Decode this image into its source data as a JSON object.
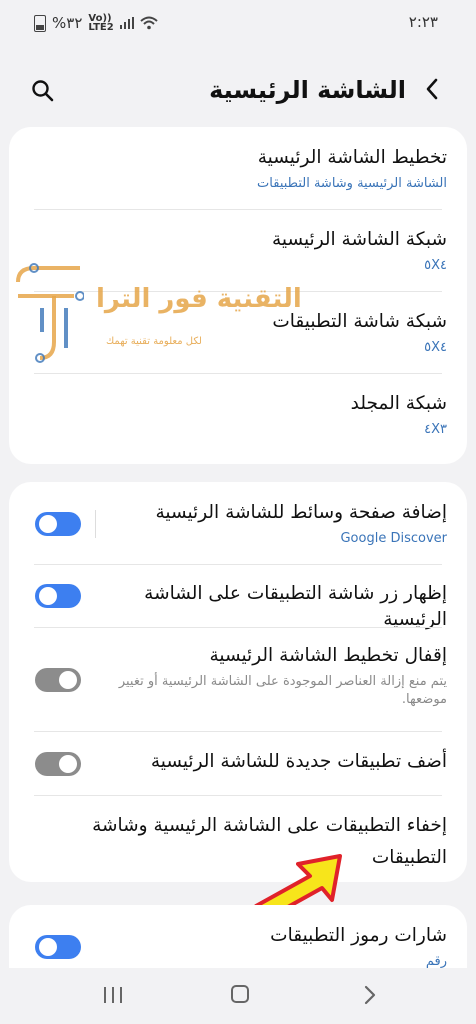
{
  "status_bar": {
    "battery": "%٣٢",
    "signal": "Vo))\nLTE2",
    "time": "٢:٢٣"
  },
  "header": {
    "title": "الشاشة الرئيسية"
  },
  "section1": {
    "items": [
      {
        "title": "تخطيط الشاشة الرئيسية",
        "subtitle": "الشاشة الرئيسية وشاشة التطبيقات"
      },
      {
        "title": "شبكة الشاشة الرئيسية",
        "subtitle": "٥X٤"
      },
      {
        "title": "شبكة شاشة التطبيقات",
        "subtitle": "٥X٤"
      },
      {
        "title": "شبكة المجلد",
        "subtitle": "٤X٣"
      }
    ]
  },
  "section2": {
    "items": [
      {
        "title": "إضافة صفحة وسائط للشاشة الرئيسية",
        "subtitle": "Google Discover",
        "toggle": "on"
      },
      {
        "title": "إظهار زر شاشة التطبيقات على الشاشة الرئيسية",
        "toggle": "on"
      },
      {
        "title": "إقفال تخطيط الشاشة الرئيسية",
        "subtitle": "يتم منع إزالة العناصر الموجودة على الشاشة الرئيسية أو تغيير موضعها.",
        "toggle": "off"
      },
      {
        "title": "أضف تطبيقات جديدة للشاشة الرئيسية",
        "toggle": "off"
      },
      {
        "title": "إخفاء التطبيقات على الشاشة الرئيسية وشاشة التطبيقات"
      }
    ]
  },
  "section3": {
    "items": [
      {
        "title": "شارات رموز التطبيقات",
        "subtitle": "رقم",
        "toggle": "on"
      }
    ]
  },
  "watermark": {
    "name": "التقنية فور الترا",
    "tagline": "لكل معلومة تقنية تهمك"
  },
  "colors": {
    "accent": "#3d7ff0",
    "subtitle_blue": "#3a74b8",
    "toggle_off": "#8c8c8c",
    "arrow_yellow": "#f7e51b",
    "arrow_red": "#e0222a",
    "watermark_orange": "#e6a64a"
  },
  "icons": [
    "back-arrow-icon",
    "search-icon",
    "recents-icon",
    "home-icon",
    "nav-back-icon"
  ]
}
